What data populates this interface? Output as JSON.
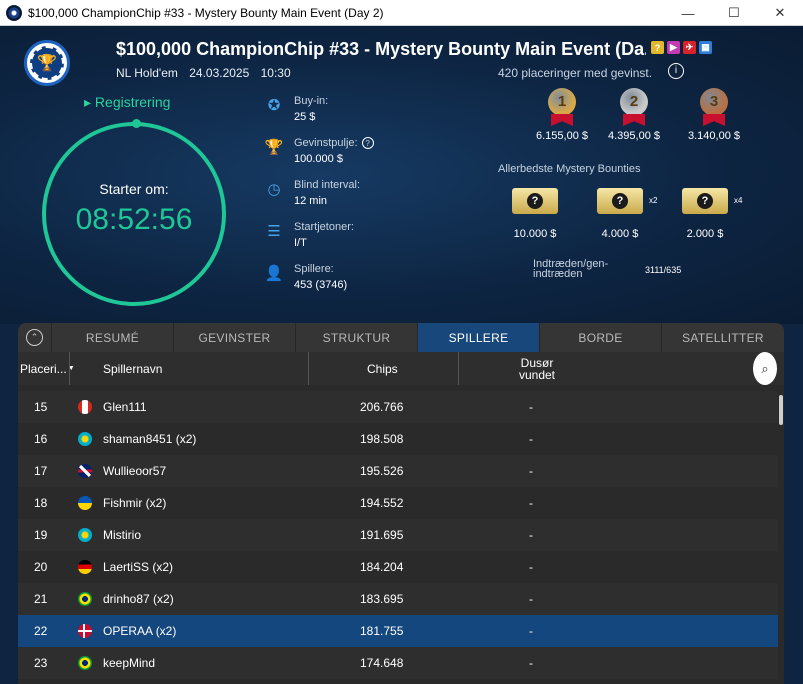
{
  "window": {
    "title": "$100,000 ChampionChip #33 - Mystery Bounty Main Event (Day 2)",
    "minimize": "—",
    "maximize": "☐",
    "close": "✕"
  },
  "tournament": {
    "title": "$100,000 ChampionChip #33 - Mystery Bounty Main Event (Da...",
    "game": "NL Hold'em",
    "date": "24.03.2025",
    "time": "10:30"
  },
  "badges": [
    {
      "icon": "question-badge-icon",
      "glyph": "?",
      "color": "#e0b92a"
    },
    {
      "icon": "video-badge-icon",
      "glyph": "▶",
      "color": "#c23bb0"
    },
    {
      "icon": "flight-badge-icon",
      "glyph": "✈",
      "color": "#d9232a"
    },
    {
      "icon": "grid-badge-icon",
      "glyph": "▦",
      "color": "#2f7ed8"
    }
  ],
  "registration": {
    "label": "Registrering"
  },
  "clock": {
    "label": "Starter om:",
    "time": "08:52:56"
  },
  "info": {
    "buyin": {
      "label": "Buy-in:",
      "value": "25 $"
    },
    "prizepool": {
      "label": "Gevinstpulje:",
      "value": "100.000 $"
    },
    "blind": {
      "label": "Blind interval:",
      "value": "12 min"
    },
    "chips": {
      "label": "Startjetoner:",
      "value": "I/T"
    },
    "players": {
      "label": "Spillere:",
      "value": "453 (3746)"
    }
  },
  "places_paid": "420 placeringer med gevinst.",
  "prizes": [
    {
      "rank": "1",
      "amount": "6.155,00 $",
      "color": "#d6a84a"
    },
    {
      "rank": "2",
      "amount": "4.395,00 $",
      "color": "#c9c9c9"
    },
    {
      "rank": "3",
      "amount": "3.140,00 $",
      "color": "#b87145"
    }
  ],
  "mystery": {
    "title": "Allerbedste Mystery Bounties",
    "items": [
      {
        "amount": "10.000 $",
        "mult": ""
      },
      {
        "amount": "4.000 $",
        "mult": "x2"
      },
      {
        "amount": "2.000 $",
        "mult": "x4"
      }
    ]
  },
  "reentry": {
    "label": "Indtræden/gen-indtræden",
    "value": "3111/635"
  },
  "tabs": [
    "RESUMÉ",
    "GEVINSTER",
    "STRUKTUR",
    "SPILLERE",
    "BORDE",
    "SATELLITTER"
  ],
  "active_tab": "SPILLERE",
  "columns": {
    "place": "Placeri...",
    "name": "Spillernavn",
    "chips": "Chips",
    "bounty": "Dusør vundet"
  },
  "players": [
    {
      "place": "15",
      "flag": "ca",
      "name": "Glen111",
      "chips": "206.766",
      "bounty": "-"
    },
    {
      "place": "16",
      "flag": "kz",
      "name": "shaman8451 (x2)",
      "chips": "198.508",
      "bounty": "-"
    },
    {
      "place": "17",
      "flag": "gb",
      "name": "Wullieoor57",
      "chips": "195.526",
      "bounty": "-"
    },
    {
      "place": "18",
      "flag": "ua",
      "name": "Fishmir (x2)",
      "chips": "194.552",
      "bounty": "-"
    },
    {
      "place": "19",
      "flag": "kz",
      "name": "Mistirio",
      "chips": "191.695",
      "bounty": "-"
    },
    {
      "place": "20",
      "flag": "de",
      "name": "LaertiSS (x2)",
      "chips": "184.204",
      "bounty": "-"
    },
    {
      "place": "21",
      "flag": "br",
      "name": "drinho87 (x2)",
      "chips": "183.695",
      "bounty": "-"
    },
    {
      "place": "22",
      "flag": "dk",
      "name": "OPERAA (x2)",
      "chips": "181.755",
      "bounty": "-",
      "selected": true
    },
    {
      "place": "23",
      "flag": "br",
      "name": "keepMind",
      "chips": "174.648",
      "bounty": "-"
    }
  ]
}
